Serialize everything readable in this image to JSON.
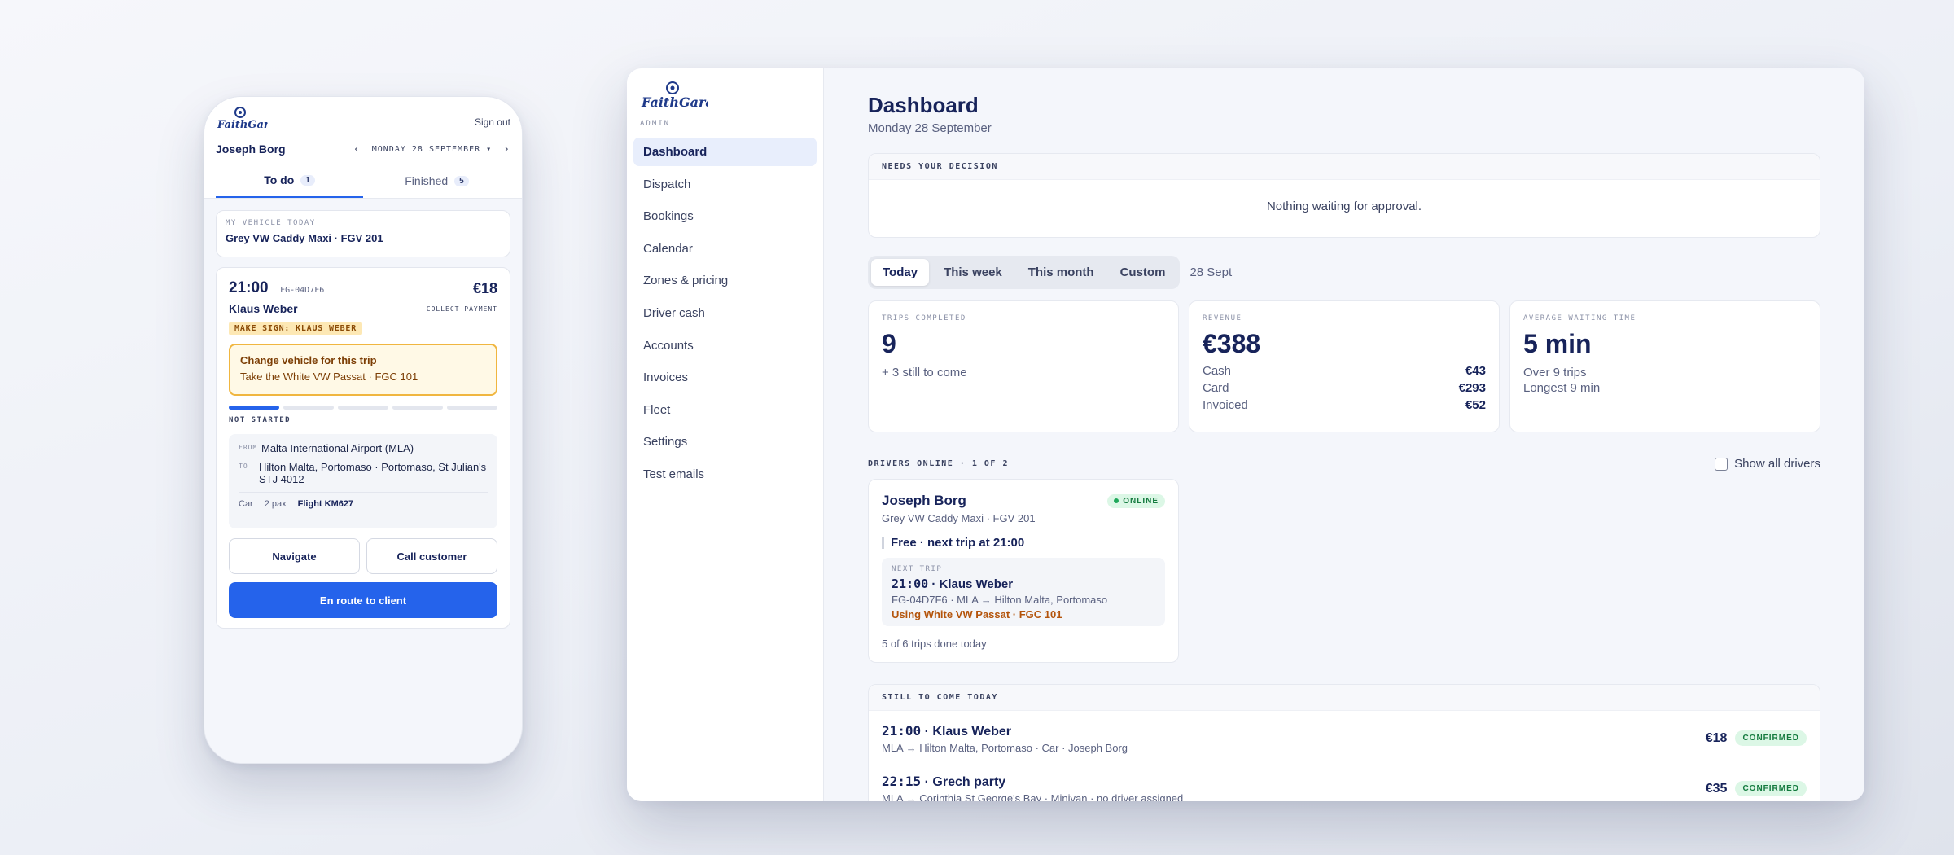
{
  "brand": {
    "logo_text": "FaithGarage",
    "admin_label": "ADMIN"
  },
  "phone": {
    "sign_out": "Sign out",
    "driver_name": "Joseph Borg",
    "date": "MONDAY 28 SEPTEMBER",
    "tabs": [
      {
        "label": "To do",
        "count": "1"
      },
      {
        "label": "Finished",
        "count": "5"
      }
    ],
    "vehicle": {
      "eyebrow": "MY VEHICLE TODAY",
      "name": "Grey VW Caddy Maxi · FGV 201"
    },
    "trip": {
      "time": "21:00",
      "ref": "FG-04D7F6",
      "price": "€18",
      "passenger": "Klaus Weber",
      "payment": "COLLECT PAYMENT",
      "sign": "MAKE SIGN: KLAUS WEBER",
      "change_title": "Change vehicle for this trip",
      "change_sub": "Take the White VW Passat · FGC 101",
      "progress": 0.2,
      "status": "NOT STARTED",
      "from_label": "FROM",
      "from": "Malta International Airport (MLA)",
      "to_label": "TO",
      "to": "Hilton Malta, Portomaso · Portomaso, St Julian's STJ 4012",
      "vehicle_type": "Car",
      "pax": "2 pax",
      "flight": "Flight KM627",
      "navigate": "Navigate",
      "call": "Call customer",
      "primary": "En route to client"
    }
  },
  "sidebar": {
    "items": [
      "Dashboard",
      "Dispatch",
      "Bookings",
      "Calendar",
      "Zones & pricing",
      "Driver cash",
      "Accounts",
      "Invoices",
      "Fleet",
      "Settings",
      "Test emails"
    ],
    "active": "Dashboard"
  },
  "dashboard": {
    "title": "Dashboard",
    "date": "Monday 28 September",
    "decision": {
      "heading": "NEEDS YOUR DECISION",
      "empty": "Nothing waiting for approval."
    },
    "ranges": [
      "Today",
      "This week",
      "This month",
      "Custom"
    ],
    "range_date": "28 Sept",
    "stats": {
      "trips": {
        "label": "TRIPS COMPLETED",
        "value": "9",
        "sub": "+ 3 still to come"
      },
      "revenue": {
        "label": "REVENUE",
        "value": "€388",
        "lines": [
          {
            "label": "Cash",
            "value": "€43"
          },
          {
            "label": "Card",
            "value": "€293"
          },
          {
            "label": "Invoiced",
            "value": "€52"
          }
        ]
      },
      "wait": {
        "label": "AVERAGE WAITING TIME",
        "value": "5 min",
        "sub1": "Over 9 trips",
        "sub2": "Longest 9 min"
      }
    },
    "drivers": {
      "heading": "DRIVERS ONLINE · 1 OF 2",
      "show_all": "Show all drivers",
      "card": {
        "name": "Joseph Borg",
        "status": "ONLINE",
        "vehicle": "Grey VW Caddy Maxi · FGV 201",
        "free": "Free · next trip at 21:00",
        "next_label": "NEXT TRIP",
        "next_time": "21:00",
        "next_name": "Klaus Weber",
        "next_route": "FG-04D7F6 · MLA → Hilton Malta, Portomaso",
        "next_warn": "Using White VW Passat · FGC 101",
        "done": "5 of 6 trips done today"
      }
    },
    "still": {
      "heading": "STILL TO COME TODAY",
      "rows": [
        {
          "time": "21:00",
          "name": "Klaus Weber",
          "sub": "MLA → Hilton Malta, Portomaso · Car · Joseph Borg",
          "price": "€18",
          "status": "CONFIRMED"
        },
        {
          "time": "22:15",
          "name": "Grech party",
          "sub": "MLA → Corinthia St George's Bay · Minivan · no driver assigned",
          "price": "€35",
          "status": "CONFIRMED"
        }
      ]
    }
  },
  "colors": {
    "accent": "#2563eb",
    "navy": "#17235a",
    "warning": "#f0b640",
    "success": "#137a3e"
  }
}
